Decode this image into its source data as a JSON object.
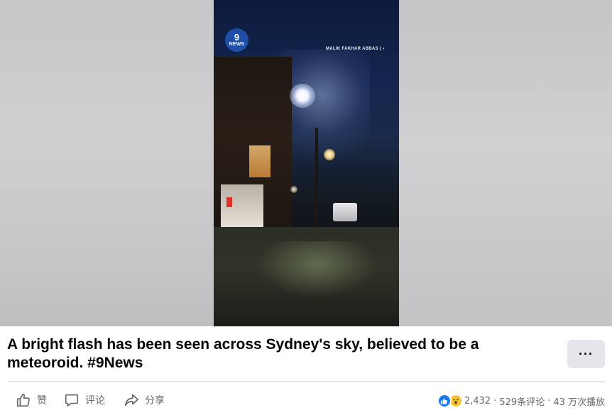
{
  "video": {
    "overlay_logo": {
      "line1": "9",
      "line2": "NEWS"
    },
    "credit_text": "MALIK FAKHAR ABBAS | ◐"
  },
  "post": {
    "title": "A bright flash has been seen across Sydney's sky, believed to be a meteoroid. #9News",
    "more_label": "···"
  },
  "actions": {
    "like_label": "赞",
    "comment_label": "评论",
    "share_label": "分享"
  },
  "stats": {
    "reaction_count": "2,432",
    "separator": "·",
    "comments": "529条评论",
    "views": "43 万次播放"
  },
  "colors": {
    "like_blue": "#1877f2",
    "wow_yellow": "#f7c531",
    "muted_text": "#65676b",
    "button_bg": "#e4e6eb"
  },
  "icons": [
    "thumbs-up-icon",
    "comment-icon",
    "share-icon",
    "like-reaction-icon",
    "wow-reaction-icon",
    "more-icon"
  ]
}
